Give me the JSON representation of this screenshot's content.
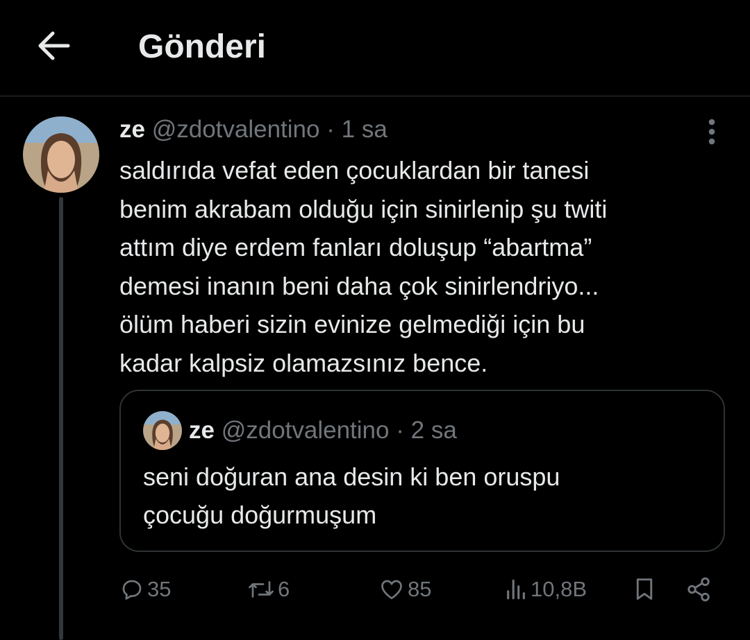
{
  "header": {
    "title": "Gönderi",
    "back_icon": "arrow-left-icon"
  },
  "post": {
    "author_name": "ze",
    "author_handle": "@zdotvalentino",
    "separator": "·",
    "time": "1 sa",
    "text_lines": [
      "saldırıda vefat eden çocuklardan bir tanesi",
      "benim akrabam olduğu için sinirlenip şu twiti",
      "attım diye erdem fanları doluşup “abartma”",
      "demesi inanın beni daha çok sinirlendriyo...",
      "ölüm haberi sizin evinize gelmediği için bu",
      "kadar kalpsiz olamazsınız bence."
    ],
    "more_icon": "more-vertical-icon"
  },
  "quote": {
    "author_name": "ze",
    "author_handle": "@zdotvalentino",
    "separator": "·",
    "time": "2 sa",
    "text_lines": [
      "seni doğuran ana desin ki ben oruspu",
      "çocuğu doğurmuşum"
    ]
  },
  "actions": {
    "reply": {
      "icon": "reply-icon",
      "count": "35"
    },
    "retweet": {
      "icon": "retweet-icon",
      "count": "6"
    },
    "like": {
      "icon": "heart-icon",
      "count": "85"
    },
    "views": {
      "icon": "views-icon",
      "count": "10,8B"
    },
    "bookmark": {
      "icon": "bookmark-icon"
    },
    "share": {
      "icon": "share-icon"
    }
  },
  "colors": {
    "background": "#000000",
    "text": "#e7e9ea",
    "secondary": "#71767b",
    "border": "#2f3336"
  }
}
